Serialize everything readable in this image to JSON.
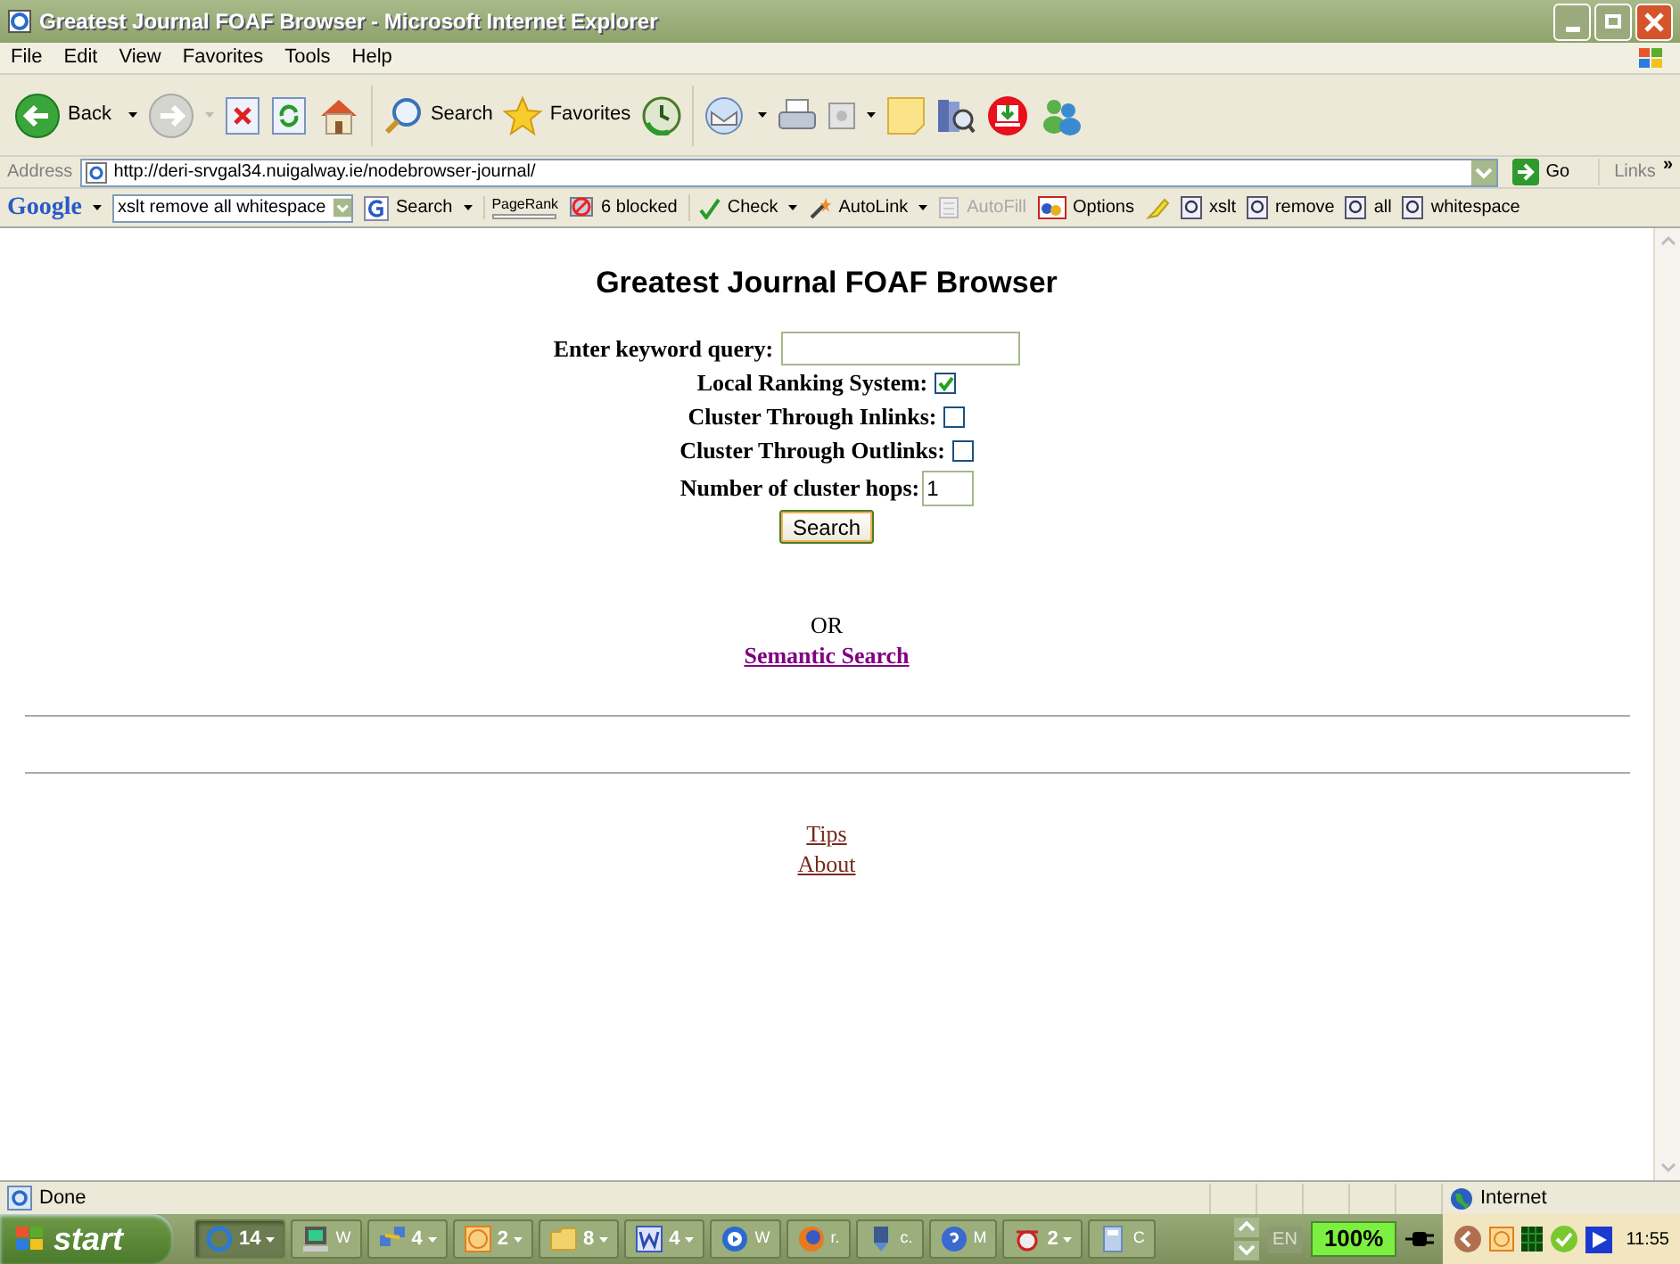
{
  "window": {
    "title": "Greatest Journal FOAF Browser - Microsoft Internet Explorer"
  },
  "menu": [
    "File",
    "Edit",
    "View",
    "Favorites",
    "Tools",
    "Help"
  ],
  "toolbar": {
    "back": "Back",
    "search": "Search",
    "favorites": "Favorites"
  },
  "address_bar": {
    "label": "Address",
    "url": "http://deri-srvgal34.nuigalway.ie/nodebrowser-journal/",
    "go": "Go",
    "links": "Links",
    "more": "»"
  },
  "google_bar": {
    "logo": "Google",
    "query": "xslt remove all whitespace",
    "search": "Search",
    "pagerank": "PageRank",
    "blocked": "6 blocked",
    "check": "Check",
    "autolink": "AutoLink",
    "autofill": {
      "label": "AutoFill",
      "disabled": true
    },
    "options": "Options",
    "highlights": [
      "xslt",
      "remove",
      "all",
      "whitespace"
    ]
  },
  "page": {
    "heading": "Greatest Journal FOAF Browser",
    "keyword": {
      "label": "Enter keyword query:"
    },
    "options": [
      {
        "label": "Local Ranking System:",
        "checked": true
      },
      {
        "label": "Cluster Through Inlinks:",
        "checked": false
      },
      {
        "label": "Cluster Through Outlinks:",
        "checked": false
      }
    ],
    "hops": {
      "label": "Number of cluster hops:",
      "value": "1"
    },
    "search_button": "Search",
    "or": "OR",
    "semantic_link": "Semantic Search",
    "footer_links": [
      "Tips",
      "About"
    ]
  },
  "status_bar": {
    "text": "Done",
    "zone": "Internet"
  },
  "taskbar": {
    "start": "start",
    "buttons": [
      {
        "label": "14",
        "dropdown": true,
        "selected": true
      },
      {
        "label": "W",
        "dropdown": false,
        "selected": false
      },
      {
        "label": "4",
        "dropdown": true,
        "selected": false
      },
      {
        "label": "2",
        "dropdown": true,
        "selected": false
      },
      {
        "label": "8",
        "dropdown": true,
        "selected": false
      },
      {
        "label": "4",
        "dropdown": true,
        "selected": false
      },
      {
        "label": "W",
        "dropdown": false,
        "selected": false
      },
      {
        "label": "r.",
        "dropdown": false,
        "selected": false
      },
      {
        "label": "c.",
        "dropdown": false,
        "selected": false
      },
      {
        "label": "M",
        "dropdown": false,
        "selected": false
      },
      {
        "label": "2",
        "dropdown": true,
        "selected": false
      },
      {
        "label": "C",
        "dropdown": false,
        "selected": false
      }
    ],
    "language": "EN",
    "battery": "100%",
    "clock": "11:55"
  }
}
